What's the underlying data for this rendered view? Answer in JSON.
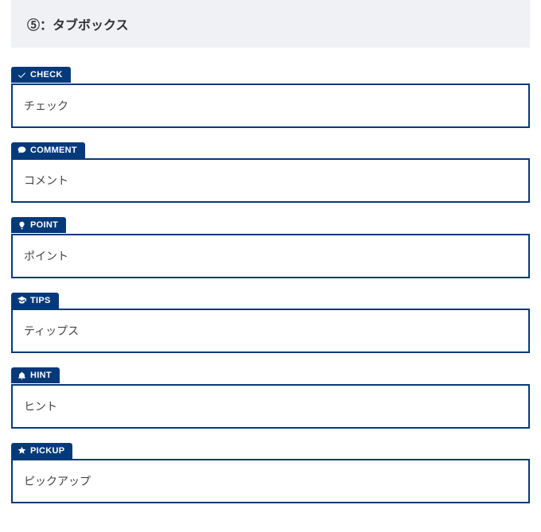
{
  "header": {
    "title": "⑤：タブボックス"
  },
  "boxes": [
    {
      "label": "CHECK",
      "content": "チェック",
      "icon": "check-icon"
    },
    {
      "label": "COMMENT",
      "content": "コメント",
      "icon": "comment-icon"
    },
    {
      "label": "POINT",
      "content": "ポイント",
      "icon": "lightbulb-icon"
    },
    {
      "label": "TIPS",
      "content": "ティップス",
      "icon": "graduation-cap-icon"
    },
    {
      "label": "HINT",
      "content": "ヒント",
      "icon": "bell-icon"
    },
    {
      "label": "PICKUP",
      "content": "ピックアップ",
      "icon": "star-icon"
    }
  ]
}
